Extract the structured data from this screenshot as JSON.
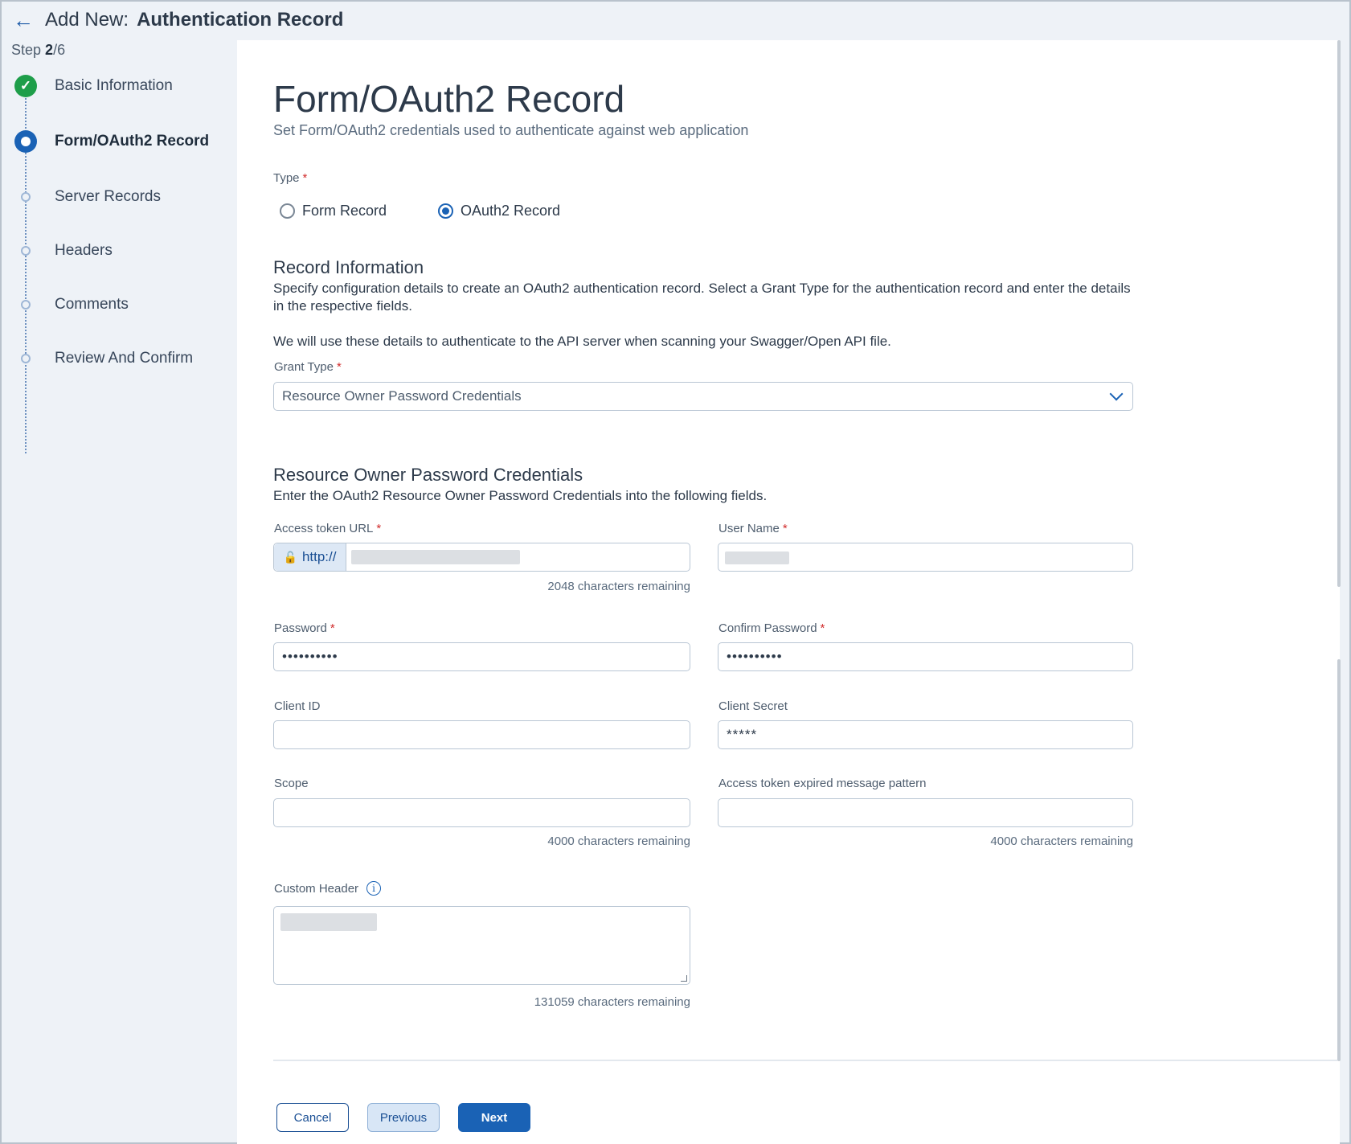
{
  "header": {
    "prefix": "Add New:",
    "title": "Authentication Record",
    "step_label": "Step",
    "step_current": "2",
    "step_total": "/6"
  },
  "steps": [
    {
      "label": "Basic Information",
      "state": "done"
    },
    {
      "label": "Form/OAuth2 Record",
      "state": "current"
    },
    {
      "label": "Server Records",
      "state": "todo"
    },
    {
      "label": "Headers",
      "state": "todo"
    },
    {
      "label": "Comments",
      "state": "todo"
    },
    {
      "label": "Review And Confirm",
      "state": "todo"
    }
  ],
  "page": {
    "title": "Form/OAuth2 Record",
    "subtitle": "Set Form/OAuth2 credentials used to authenticate against web application"
  },
  "type": {
    "label": "Type",
    "options": [
      "Form Record",
      "OAuth2 Record"
    ],
    "selected": "OAuth2 Record"
  },
  "record_info": {
    "heading": "Record Information",
    "desc1": "Specify configuration details to create an OAuth2 authentication record. Select a Grant Type for the authentication record and enter the details in the respective fields.",
    "desc2": "We will use these details to authenticate to the API server when scanning your Swagger/Open API file."
  },
  "grant_type": {
    "label": "Grant Type",
    "value": "Resource Owner Password Credentials"
  },
  "ropc": {
    "heading": "Resource Owner Password Credentials",
    "desc": "Enter the OAuth2 Resource Owner Password Credentials into the following fields."
  },
  "fields": {
    "access_token_url": {
      "label": "Access token URL",
      "prefix": "http://",
      "helper": "2048 characters remaining"
    },
    "user_name": {
      "label": "User Name"
    },
    "password": {
      "label": "Password",
      "value": "••••••••••"
    },
    "confirm_password": {
      "label": "Confirm Password",
      "value": "••••••••••"
    },
    "client_id": {
      "label": "Client ID",
      "value": ""
    },
    "client_secret": {
      "label": "Client Secret",
      "value": "*****"
    },
    "scope": {
      "label": "Scope",
      "value": "",
      "helper": "4000 characters remaining"
    },
    "expired_pattern": {
      "label": "Access token expired message pattern",
      "value": "",
      "helper": "4000 characters remaining"
    },
    "custom_header": {
      "label": "Custom Header",
      "helper": "131059 characters remaining"
    }
  },
  "buttons": {
    "cancel": "Cancel",
    "previous": "Previous",
    "next": "Next"
  },
  "colors": {
    "primary": "#1a62b5",
    "success": "#1e9e4a",
    "required": "#d12c2c"
  }
}
